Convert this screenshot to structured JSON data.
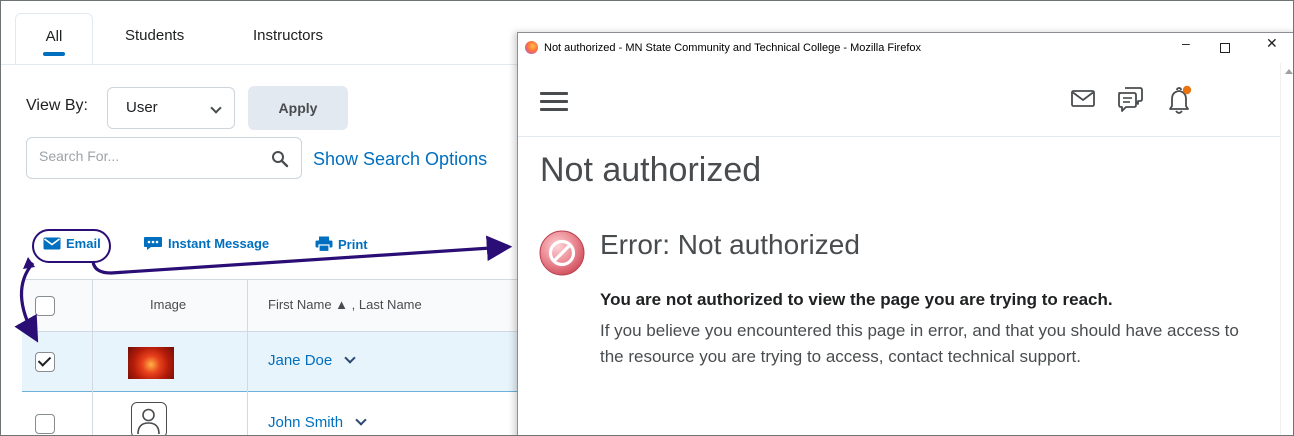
{
  "tabs": [
    {
      "label": "All"
    },
    {
      "label": "Students"
    },
    {
      "label": "Instructors"
    }
  ],
  "viewby": {
    "label": "View By:",
    "selected": "User",
    "apply_label": "Apply"
  },
  "search": {
    "placeholder": "Search For...",
    "show_options_label": "Show Search Options"
  },
  "actions": {
    "email": "Email",
    "instant_message": "Instant Message",
    "print": "Print"
  },
  "grid": {
    "columns": {
      "image": "Image",
      "name": "First Name ▲ , Last Name"
    },
    "rows": [
      {
        "name": "Jane Doe",
        "checked": true
      },
      {
        "name": "John Smith",
        "checked": false
      }
    ]
  },
  "browser": {
    "title": "Not authorized - MN State Community and Technical College - Mozilla Firefox",
    "min_label": "–",
    "close_label": "✕"
  },
  "error_page": {
    "title": "Not authorized",
    "heading": "Error: Not authorized",
    "bold_text": "You are not authorized to view the page you are trying to reach.",
    "body_text": "If you believe you encountered this page in error, and that you should have access to the resource you are trying to access, contact technical support."
  },
  "colors": {
    "link": "#006fbf",
    "annotation": "#2a0d75",
    "notification_dot": "#e87511"
  }
}
